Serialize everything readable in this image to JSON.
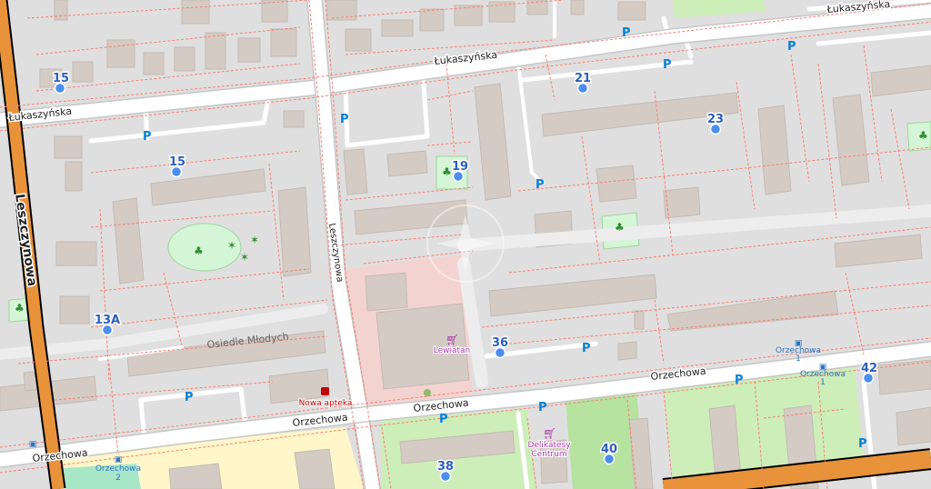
{
  "map": {
    "streets": {
      "lukaszynska": "Łukaszyńska",
      "leszczynowa": "Leszczynowa",
      "orzechowa": "Orzechowa"
    },
    "places": {
      "osiedle": "Osiedle Młodych"
    },
    "shops": {
      "lewiatan": "Lewiatan",
      "delikatesy_line1": "Delikatesy",
      "delikatesy_line2": "Centrum",
      "apteka": "Nowa apteka"
    },
    "bus_stops": {
      "orzechowa_1": "Orzechowa",
      "orzechowa_1_ref": "1",
      "orzechowa_2": "Orzechowa",
      "orzechowa_2_ref": "2"
    },
    "house_numbers": {
      "n15a": "15",
      "n15b": "15",
      "n19": "19",
      "n21": "21",
      "n23": "23",
      "n13a": "13A",
      "n36": "36",
      "n38": "38",
      "n40": "40",
      "n42": "42"
    },
    "parking_label": "P",
    "colors": {
      "background": "#e0dfdf",
      "building": "#d9d0c9",
      "road": "#ffffff",
      "primary_road": "#e8923a",
      "park": "#c8facc",
      "footway": "#fa8072",
      "retail": "#ffd6d1",
      "address_marker": "#4a8ef0",
      "parking_text": "#0b7fd6"
    }
  }
}
